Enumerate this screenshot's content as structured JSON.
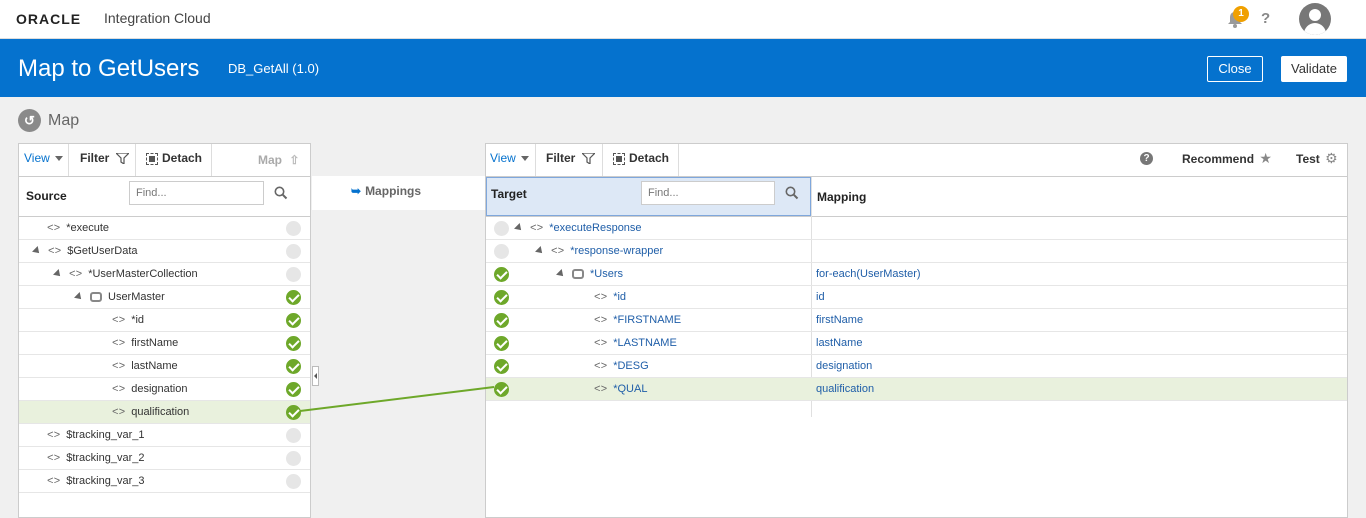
{
  "topbar": {
    "logo": "ORACLE",
    "product": "Integration Cloud",
    "notification_count": "1",
    "help": "?"
  },
  "header": {
    "title": "Map to GetUsers",
    "subtitle": "DB_GetAll (1.0)",
    "close_label": "Close",
    "validate_label": "Validate",
    "background": "#0572ce"
  },
  "map_label": "Map",
  "source": {
    "toolbar": {
      "view": "View",
      "filter": "Filter",
      "detach": "Detach",
      "map": "Map"
    },
    "title": "Source",
    "find_placeholder": "Find...",
    "nodes": [
      {
        "label": "*execute",
        "status": "empty"
      },
      {
        "label": "$GetUserData",
        "status": "empty"
      },
      {
        "label": "*UserMasterCollection",
        "status": "empty"
      },
      {
        "label": "UserMaster",
        "status": "ok"
      },
      {
        "label": "*id",
        "status": "ok"
      },
      {
        "label": "firstName",
        "status": "ok"
      },
      {
        "label": "lastName",
        "status": "ok"
      },
      {
        "label": "designation",
        "status": "ok"
      },
      {
        "label": "qualification",
        "status": "ok",
        "selected": true
      },
      {
        "label": "$tracking_var_1",
        "status": "empty"
      },
      {
        "label": "$tracking_var_2",
        "status": "empty"
      },
      {
        "label": "$tracking_var_3",
        "status": "empty"
      }
    ]
  },
  "middle": {
    "mappings_label": "Mappings"
  },
  "target": {
    "toolbar": {
      "view": "View",
      "filter": "Filter",
      "detach": "Detach",
      "recommend": "Recommend",
      "test": "Test"
    },
    "title": "Target",
    "find_placeholder": "Find...",
    "mapping_header": "Mapping",
    "nodes": [
      {
        "label": "*executeResponse",
        "status": "empty",
        "mapping": ""
      },
      {
        "label": "*response-wrapper",
        "status": "empty",
        "mapping": ""
      },
      {
        "label": "*Users",
        "status": "ok",
        "mapping": "for-each(UserMaster)"
      },
      {
        "label": "*id",
        "status": "ok",
        "mapping": "id"
      },
      {
        "label": "*FIRSTNAME",
        "status": "ok",
        "mapping": "firstName"
      },
      {
        "label": "*LASTNAME",
        "status": "ok",
        "mapping": "lastName"
      },
      {
        "label": "*DESG",
        "status": "ok",
        "mapping": "designation"
      },
      {
        "label": "*QUAL",
        "status": "ok",
        "mapping": "qualification",
        "selected": true
      }
    ]
  },
  "colors": {
    "ok": "#6ea82a",
    "empty": "#e6e6e6",
    "selected_row": "#e9f1dd",
    "link": "#1f5ea8"
  }
}
